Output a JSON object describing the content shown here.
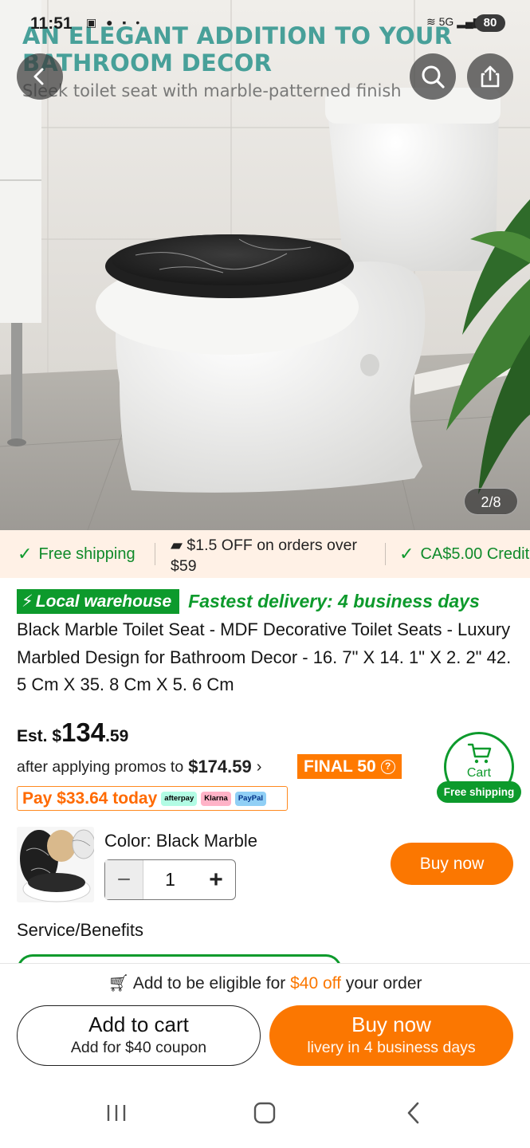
{
  "status_bar": {
    "time": "11:51",
    "network": "5G",
    "battery": "80"
  },
  "hero": {
    "banner_title_line1": "AN ELEGANT ADDITION TO YOUR",
    "banner_title_line2": "BATHROOM DECOR",
    "banner_subtitle": "Sleek toilet seat with marble-patterned finish",
    "image_counter": "2/8"
  },
  "promo_strip": {
    "free_shipping": "Free shipping",
    "discount": "$1.5 OFF on orders over $59",
    "credit": "CA$5.00 Credit"
  },
  "product": {
    "warehouse_badge": "Local warehouse",
    "delivery_text": "Fastest delivery: 4 business days",
    "title": "Black Marble Toilet Seat - MDF Decorative Toilet Seats - Luxury Marbled Design for Bathroom Decor - 16. 7\" X 14. 1\" X 2. 2\" 42. 5 Cm X 35. 8 Cm X 5. 6 Cm",
    "price_prefix": "Est. $",
    "price_whole": "134",
    "price_cents": ".59",
    "after_promos_label": "after applying promos to",
    "original_price": "$174.59",
    "final_badge": "FINAL 50",
    "pay_today": "Pay $33.64 today",
    "pay_logos": [
      "afterpay",
      "Klarna",
      "PayPal"
    ],
    "cart_label": "Cart",
    "cart_free_shipping": "Free shipping",
    "color_label": "Color: Black Marble",
    "quantity": "1",
    "buy_now_small": "Buy now",
    "service_heading": "Service/Benefits"
  },
  "bottom_bar": {
    "eligible_prefix": "Add to be eligible for",
    "eligible_amount": "$40 off",
    "eligible_suffix": "your order",
    "add_to_cart": "Add to cart",
    "add_to_cart_sub": "Add for $40 coupon",
    "buy_now": "Buy now",
    "buy_now_sub": "livery in 4 business days"
  },
  "colors": {
    "accent_orange": "#fb7701",
    "success_green": "#0d9a2c",
    "banner_teal": "#3a9a93",
    "promo_bg": "#fff1e6"
  }
}
